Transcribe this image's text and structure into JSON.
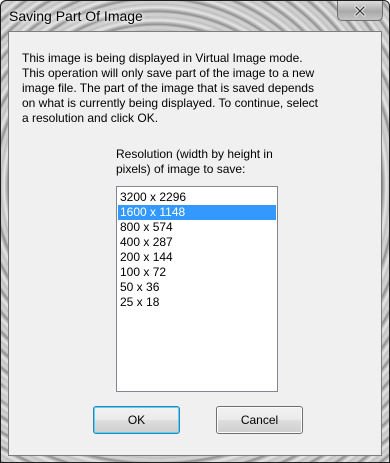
{
  "window": {
    "title": "Saving Part Of Image",
    "close_icon": "close-icon"
  },
  "dialog": {
    "message": "This image is being displayed in Virtual Image mode.\nThis operation will only save part of the image to a new\nimage file.  The part of the image that is saved depends\non what is currently being displayed.  To continue, select\na resolution and click OK.",
    "resolution_label": "Resolution (width by height in\npixels) of image to save:",
    "resolutions": [
      {
        "label": "3200 x 2296",
        "selected": false
      },
      {
        "label": "1600 x 1148",
        "selected": true
      },
      {
        "label": "800 x 574",
        "selected": false
      },
      {
        "label": "400 x 287",
        "selected": false
      },
      {
        "label": "200 x 144",
        "selected": false
      },
      {
        "label": "100 x 72",
        "selected": false
      },
      {
        "label": "50 x 36",
        "selected": false
      },
      {
        "label": "25 x 18",
        "selected": false
      }
    ],
    "ok_label": "OK",
    "cancel_label": "Cancel"
  },
  "colors": {
    "selection": "#3399ff",
    "dialog_bg": "#f0f0f0"
  }
}
